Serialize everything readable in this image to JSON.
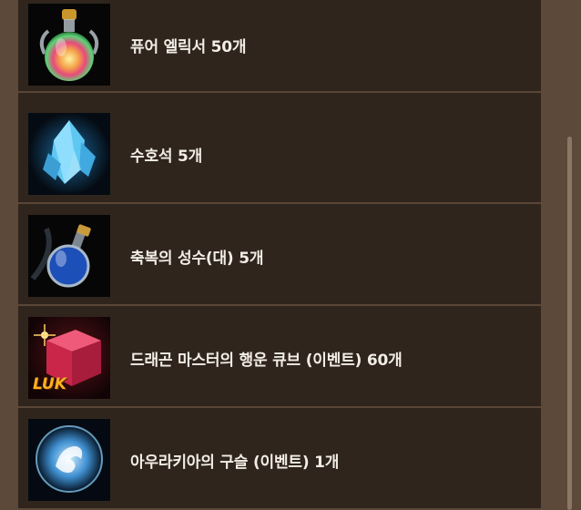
{
  "items": [
    {
      "icon": "rainbow-elixir-icon",
      "label": "퓨어 엘릭서 50개"
    },
    {
      "icon": "blue-crystal-icon",
      "label": "수호석 5개"
    },
    {
      "icon": "blue-potion-icon",
      "label": "축복의 성수(대) 5개"
    },
    {
      "icon": "red-cube-icon",
      "label": "드래곤 마스터의 행운 큐브 (이벤트) 60개",
      "badge": "LUK"
    },
    {
      "icon": "aura-orb-icon",
      "label": "아우라키아의 구슬 (이벤트) 1개"
    }
  ],
  "colors": {
    "panel": "#2f251d",
    "background": "#5c4939",
    "divider": "#5a4636",
    "text": "#f2ede6"
  }
}
